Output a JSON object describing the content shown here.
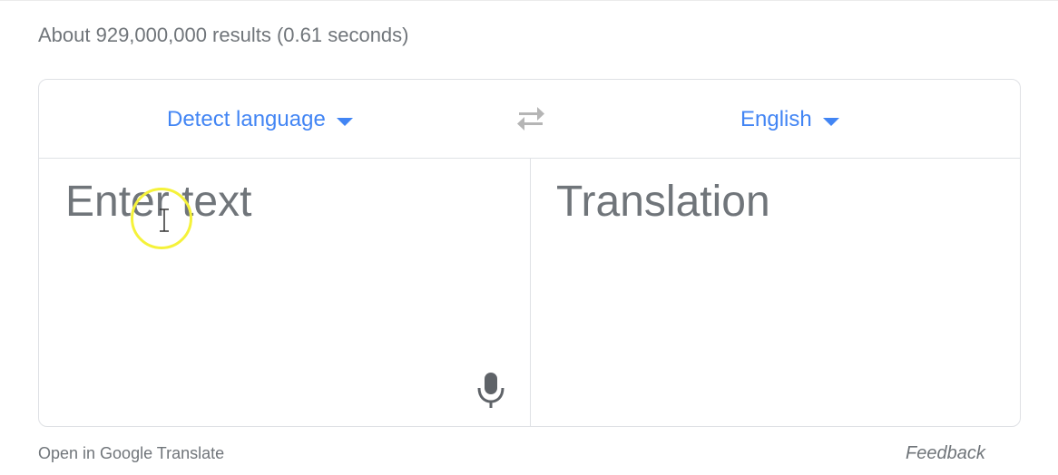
{
  "results": {
    "stats_text": "About 929,000,000 results (0.61 seconds)"
  },
  "translate": {
    "source_language": "Detect language",
    "target_language": "English",
    "input_placeholder": "Enter text",
    "input_value": "",
    "translation_placeholder": "Translation",
    "colors": {
      "accent": "#4285f4",
      "muted_text": "#70757a",
      "border": "#dfe1e5",
      "swap_icon": "#b5b5b5",
      "mic_icon": "#5f6368",
      "cursor_highlight": "#f5f23a"
    },
    "icons": {
      "swap": "swap-languages-icon",
      "mic": "microphone-icon",
      "caret": "chevron-down-icon",
      "cursor": "text-cursor-icon"
    }
  },
  "footer": {
    "open_link": "Open in Google Translate",
    "feedback_link": "Feedback"
  }
}
